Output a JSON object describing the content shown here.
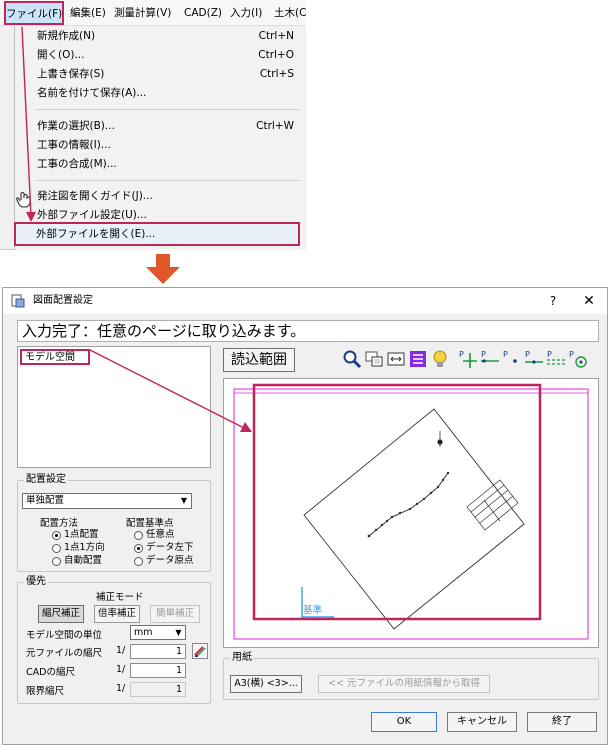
{
  "menubar": {
    "items": [
      {
        "label": "ファイル(F)"
      },
      {
        "label": "編集(E)"
      },
      {
        "label": "測量計算(V)"
      },
      {
        "label": "CAD(Z)"
      },
      {
        "label": "入力(I)"
      },
      {
        "label": "土木(C"
      }
    ]
  },
  "file_menu": {
    "items": [
      {
        "label": "新規作成(N)",
        "shortcut": "Ctrl+N"
      },
      {
        "label": "開く(O)...",
        "shortcut": "Ctrl+O"
      },
      {
        "label": "上書き保存(S)",
        "shortcut": "Ctrl+S"
      },
      {
        "label": "名前を付けて保存(A)...",
        "shortcut": ""
      },
      {
        "label": "作業の選択(B)...",
        "shortcut": "Ctrl+W"
      },
      {
        "label": "工事の情報(I)...",
        "shortcut": ""
      },
      {
        "label": "工事の合成(M)...",
        "shortcut": ""
      },
      {
        "label": "発注図を開くガイド(J)...",
        "shortcut": ""
      },
      {
        "label": "外部ファイル設定(U)...",
        "shortcut": ""
      },
      {
        "label": "外部ファイルを開く(E)...",
        "shortcut": ""
      }
    ]
  },
  "dialog": {
    "title": "図面配置設定",
    "help": "?",
    "close": "✕",
    "status": "入力完了：任意のページに取り込みます。",
    "model_list": {
      "items": [
        "モデル空間"
      ]
    },
    "read_range_label": "読込範囲",
    "preview": {
      "base_label": "基準"
    },
    "placement": {
      "group_label": "配置設定",
      "selected": "単独配置",
      "method_label": "配置方法",
      "method_options": [
        "1点配置",
        "1点1方向",
        "自動配置"
      ],
      "method_selected": 0,
      "base_label": "配置基準点",
      "base_options": [
        "任意点",
        "データ左下",
        "データ原点"
      ],
      "base_selected": 1
    },
    "priority": {
      "group_label": "優先",
      "mode_label": "補正モード",
      "modes": [
        "縮尺補正",
        "倍率補正",
        "簡単補正"
      ],
      "unit_label": "モデル空間の単位",
      "unit_value": "mm",
      "src_scale_label": "元ファイルの縮尺",
      "src_scale_value": "1",
      "cad_scale_label": "CADの縮尺",
      "cad_scale_value": "1",
      "limit_scale_label": "限界縮尺",
      "limit_scale_value": "1",
      "slash": "1/"
    },
    "paper": {
      "group_label": "用紙",
      "size_button": "A3(横) <3>...",
      "fetch_button": "<< 元ファイルの用紙情報から取得"
    },
    "footer": {
      "ok": "OK",
      "cancel": "キャンセル",
      "exit": "終了"
    }
  },
  "colors": {
    "highlight": "#c0245c",
    "orange_arrow": "#e0572a",
    "magenta_frame": "#e020e0",
    "base_axis": "#3aa0e8"
  }
}
